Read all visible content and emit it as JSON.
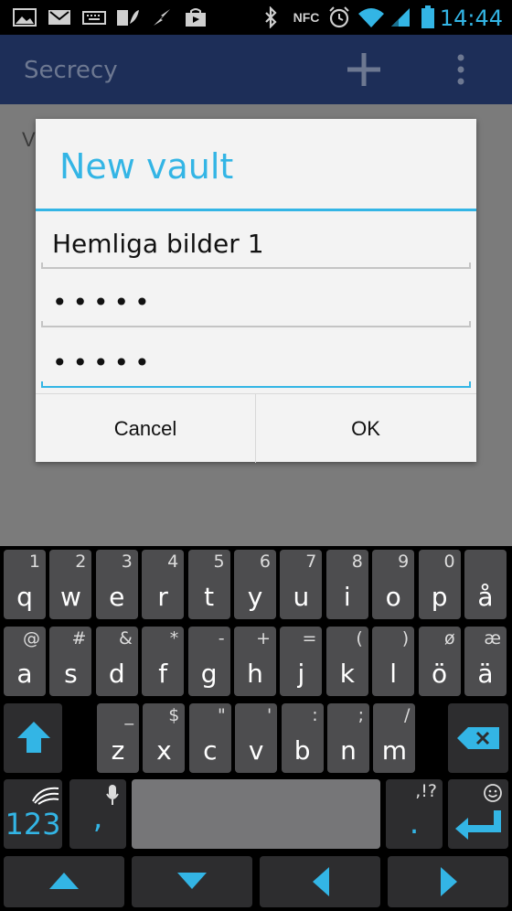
{
  "status_bar": {
    "time": "14:44",
    "nfc_label": "NFC",
    "icons": [
      "gallery-icon",
      "gmail-icon",
      "keyboard-icon",
      "sim-icon",
      "bolt-icon",
      "shop-icon",
      "bluetooth-icon",
      "nfc-icon",
      "alarm-icon",
      "wifi-icon",
      "signal-icon",
      "battery-icon"
    ],
    "accent": "#33b5e5"
  },
  "action_bar": {
    "title": "Secrecy",
    "add_icon": "plus-icon",
    "menu_icon": "overflow-menu-icon",
    "background": "#1d2e58"
  },
  "background_content": {
    "partial_text": "V"
  },
  "dialog": {
    "title": "New vault",
    "fields": [
      {
        "name": "vault-name",
        "value": "Hemliga bilder 1"
      },
      {
        "name": "password",
        "value": "•••••"
      },
      {
        "name": "password-confirm",
        "value": "•••••"
      }
    ],
    "cancel_label": "Cancel",
    "ok_label": "OK"
  },
  "keyboard": {
    "row1": [
      {
        "m": "q",
        "s": "1"
      },
      {
        "m": "w",
        "s": "2"
      },
      {
        "m": "e",
        "s": "3"
      },
      {
        "m": "r",
        "s": "4"
      },
      {
        "m": "t",
        "s": "5"
      },
      {
        "m": "y",
        "s": "6"
      },
      {
        "m": "u",
        "s": "7"
      },
      {
        "m": "i",
        "s": "8"
      },
      {
        "m": "o",
        "s": "9"
      },
      {
        "m": "p",
        "s": "0"
      },
      {
        "m": "å",
        "s": ""
      }
    ],
    "row2": [
      {
        "m": "a",
        "s": "@"
      },
      {
        "m": "s",
        "s": "#"
      },
      {
        "m": "d",
        "s": "&"
      },
      {
        "m": "f",
        "s": "*"
      },
      {
        "m": "g",
        "s": "-"
      },
      {
        "m": "h",
        "s": "+"
      },
      {
        "m": "j",
        "s": "="
      },
      {
        "m": "k",
        "s": "("
      },
      {
        "m": "l",
        "s": ")"
      },
      {
        "m": "ö",
        "s": "ø"
      },
      {
        "m": "ä",
        "s": "æ"
      }
    ],
    "row3": [
      {
        "m": "z",
        "s": "_"
      },
      {
        "m": "x",
        "s": "$"
      },
      {
        "m": "c",
        "s": "\""
      },
      {
        "m": "v",
        "s": "'"
      },
      {
        "m": "b",
        "s": ":"
      },
      {
        "m": "n",
        "s": ";"
      },
      {
        "m": "m",
        "s": "/"
      }
    ],
    "numbers_label": "123",
    "comma_label": ",",
    "period_label": ".",
    "period_secondary": ",!?",
    "accent": "#33b5e5"
  }
}
